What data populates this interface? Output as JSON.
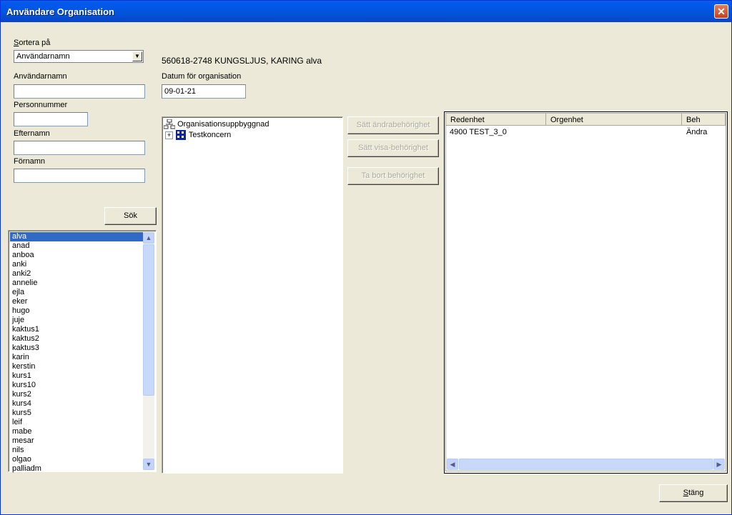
{
  "window": {
    "title": "Användare Organisation",
    "close": "✕"
  },
  "sort": {
    "label": "Sortera på",
    "value": "Användarnamn"
  },
  "fields": {
    "username_label": "Användarnamn",
    "username_value": "",
    "personnummer_label": "Personnummer",
    "personnummer_value": "",
    "efternamn_label": "Efternamn",
    "efternamn_value": "",
    "fornamn_label": "Förnamn",
    "fornamn_value": ""
  },
  "search_button": "Sök",
  "user_info": "560618-2748 KUNGSLJUS, KARING alva",
  "date": {
    "label": "Datum för organisation",
    "value": "09-01-21"
  },
  "users": [
    "alva",
    "anad",
    "anboa",
    "anki",
    "anki2",
    "annelie",
    "ejla",
    "eker",
    "hugo",
    "juje",
    "kaktus1",
    "kaktus2",
    "kaktus3",
    "karin",
    "kerstin",
    "kurs1",
    "kurs10",
    "kurs2",
    "kurs4",
    "kurs5",
    "leif",
    "mabe",
    "mesar",
    "nils",
    "olgao",
    "palliadm"
  ],
  "tree": {
    "root": "Organisationsuppbyggnad",
    "child": "Testkoncern",
    "expander": "+"
  },
  "perm_buttons": {
    "set_change": "Sätt ändrabehörighet",
    "set_view": "Sätt visa-behörighet",
    "remove": "Ta bort behörighet"
  },
  "table": {
    "headers": [
      "Redenhet",
      "Orgenhet",
      "Beh"
    ],
    "rows": [
      {
        "redenhet": "4900 TEST_3_0",
        "orgenhet": "",
        "beh": "Ändra"
      }
    ]
  },
  "close_button": "Stäng",
  "icons": {
    "tree_root": "org-chart-icon",
    "tree_child": "company-icon"
  },
  "colors": {
    "title_bar": "#0054e3",
    "selection": "#316ac5",
    "face": "#ece9d8"
  }
}
